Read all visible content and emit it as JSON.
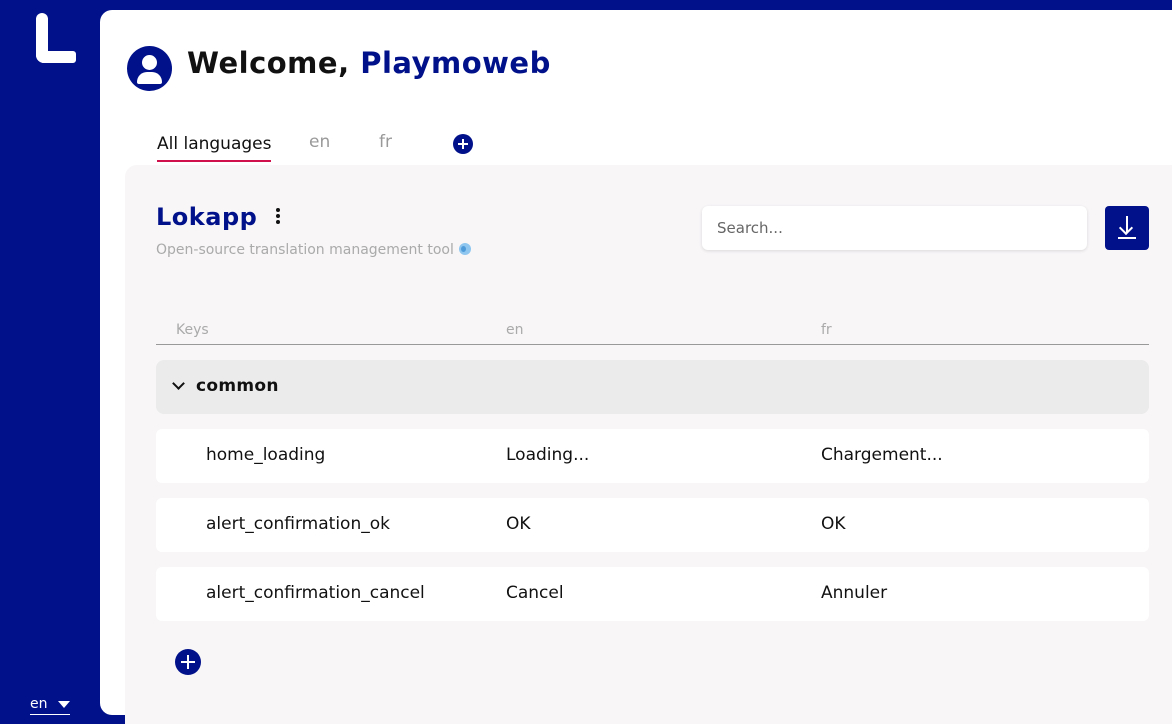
{
  "sidebar": {
    "logo": "L",
    "language_select": "en"
  },
  "header": {
    "welcome_prefix": "Welcome,",
    "user_name": "Playmoweb"
  },
  "tabs": [
    {
      "label": "All languages",
      "active": true
    },
    {
      "label": "en",
      "active": false
    },
    {
      "label": "fr",
      "active": false
    }
  ],
  "project": {
    "title": "Lokapp",
    "description": "Open-source translation management tool"
  },
  "search": {
    "placeholder": "Search..."
  },
  "table": {
    "headers": [
      "Keys",
      "en",
      "fr"
    ],
    "group": "common",
    "rows": [
      {
        "key": "home_loading",
        "en": "Loading...",
        "fr": "Chargement..."
      },
      {
        "key": "alert_confirmation_ok",
        "en": "OK",
        "fr": "OK"
      },
      {
        "key": "alert_confirmation_cancel",
        "en": "Cancel",
        "fr": "Annuler"
      }
    ]
  },
  "colors": {
    "brand": "#00118a",
    "tab_underline": "#d0104c",
    "content_bg": "#f8f6f7"
  },
  "icons": [
    "logo-icon",
    "avatar-icon",
    "add-language-icon",
    "more-vertical-icon",
    "globe-icon",
    "download-icon",
    "chevron-down-icon",
    "add-key-icon",
    "caret-down-icon"
  ]
}
